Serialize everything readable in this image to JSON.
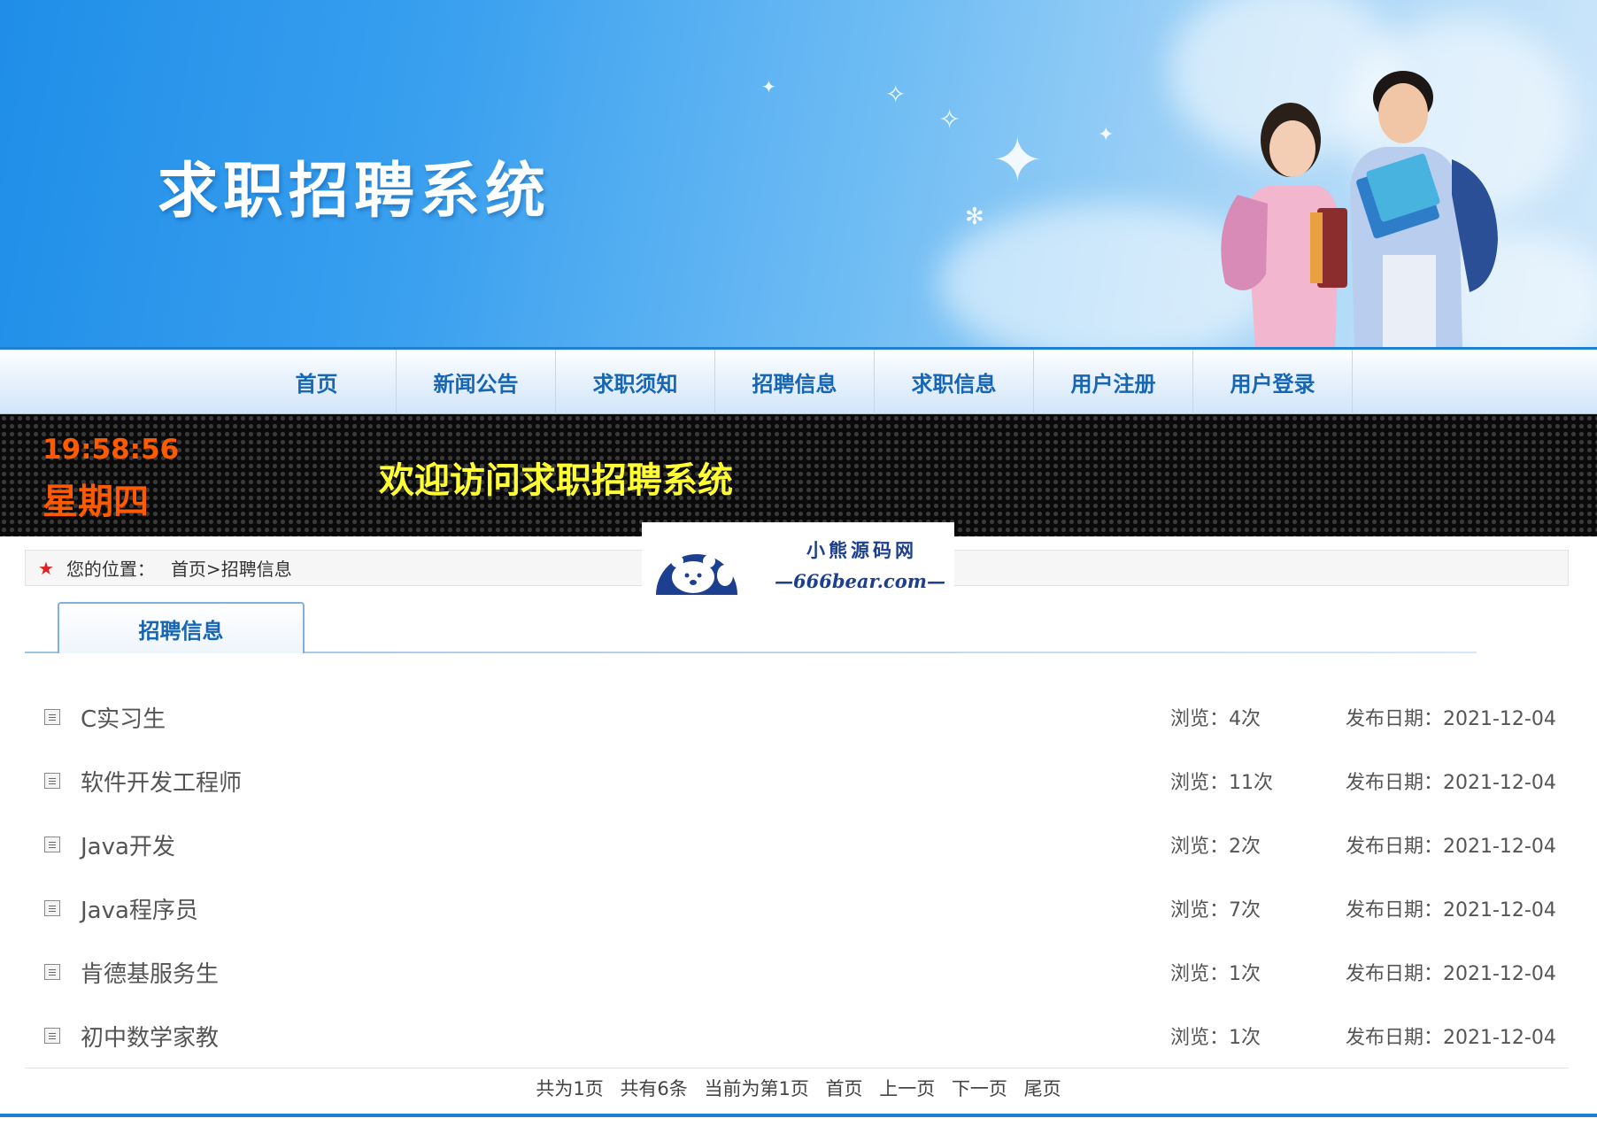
{
  "header": {
    "title": "求职招聘系统"
  },
  "nav": {
    "items": [
      "首页",
      "新闻公告",
      "求职须知",
      "招聘信息",
      "求职信息",
      "用户注册",
      "用户登录"
    ]
  },
  "ticker": {
    "time": "19:58:56",
    "weekday": "星期四",
    "welcome": "欢迎访问求职招聘系统"
  },
  "breadcrumb": {
    "label": "您的位置：",
    "path": "首页>招聘信息"
  },
  "watermark": {
    "name": "小熊源码网",
    "url": "—666bear.com—"
  },
  "section": {
    "tab": "招聘信息"
  },
  "jobs": [
    {
      "title": "C实习生",
      "views": "浏览：4次",
      "date": "发布日期：2021-12-04"
    },
    {
      "title": "软件开发工程师",
      "views": "浏览：11次",
      "date": "发布日期：2021-12-04"
    },
    {
      "title": "Java开发",
      "views": "浏览：2次",
      "date": "发布日期：2021-12-04"
    },
    {
      "title": "Java程序员",
      "views": "浏览：7次",
      "date": "发布日期：2021-12-04"
    },
    {
      "title": "肯德基服务生",
      "views": "浏览：1次",
      "date": "发布日期：2021-12-04"
    },
    {
      "title": "初中数学家教",
      "views": "浏览：1次",
      "date": "发布日期：2021-12-04"
    }
  ],
  "pager": {
    "total_pages": "共为1页",
    "total_items": "共有6条",
    "current": "当前为第1页",
    "first": "首页",
    "prev": "上一页",
    "next": "下一页",
    "last": "尾页"
  },
  "colors": {
    "nav_text": "#1766b5",
    "led_time": "#ff5a00",
    "led_welcome": "#ffff33",
    "accent": "#1f7fd0"
  }
}
